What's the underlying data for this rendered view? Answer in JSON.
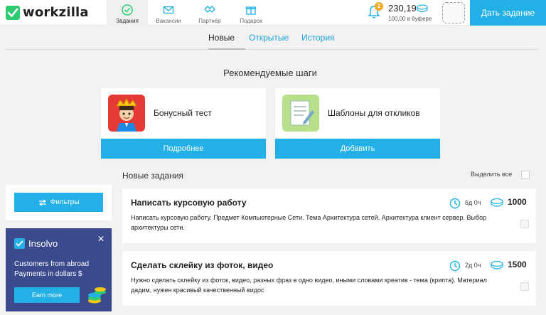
{
  "header": {
    "logo_text": "workzilla",
    "nav": [
      {
        "label": "Задания",
        "icon": "checkmark-circle-icon",
        "active": true
      },
      {
        "label": "Вакансии",
        "icon": "envelope-icon",
        "active": false
      },
      {
        "label": "Партнёр",
        "icon": "handshake-icon",
        "active": false
      },
      {
        "label": "Подарок",
        "icon": "gift-icon",
        "active": false
      }
    ],
    "notifications_count": "2",
    "balance_amount": "230,19",
    "balance_buffer": "100,00 в буфере",
    "cta_label": "Дать задание"
  },
  "tabs": [
    {
      "label": "Новые",
      "active": true
    },
    {
      "label": "Открытые",
      "active": false
    },
    {
      "label": "История",
      "active": false
    }
  ],
  "recommended": {
    "title": "Рекомендуемые шаги",
    "cards": [
      {
        "text": "Бонусный тест",
        "button": "Подробнее",
        "icon": "king-avatar-icon"
      },
      {
        "text": "Шаблоны для откликов",
        "button": "Добавить",
        "icon": "document-pen-icon"
      }
    ]
  },
  "sidebar": {
    "filter_label": "Фильтры",
    "promo": {
      "brand": "Insolvo",
      "line1": "Customers from abroad",
      "line2": "Payments in dollars $",
      "button": "Earn more"
    }
  },
  "tasks_section": {
    "title": "Новые задания",
    "select_all": "Выделить все",
    "tasks": [
      {
        "title": "Написать курсовую работу",
        "description": "Написать курсовую работу. Предмет Компьютерные Сети. Тема Архитектура сетей. Архитектура клиент сервер. Выбор архитектуры сети.",
        "time": "6д 0ч",
        "price": "1000"
      },
      {
        "title": "Сделать склейку из фоток, видео",
        "description": "Нужно сделать склейку из фоток, видео, разных фраз в одно видео, иными словами креатив - тема (крипта). Материал дадим, нужен красивый качественный видос",
        "time": "2д 0ч",
        "price": "1500"
      }
    ]
  },
  "colors": {
    "accent": "#23b0e6",
    "promo_bg": "#3a4a8c",
    "logo_green": "#2ecc71",
    "badge": "#f5a623"
  }
}
